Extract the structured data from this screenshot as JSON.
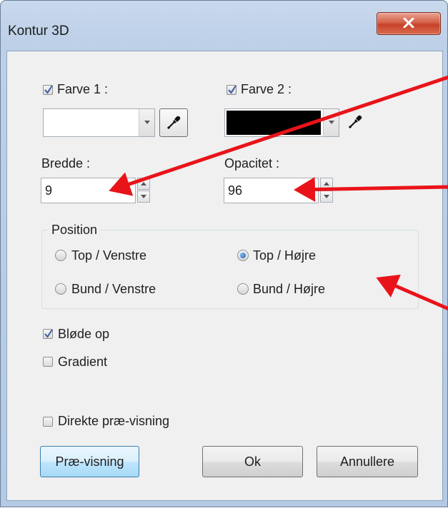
{
  "window": {
    "title": "Kontur 3D",
    "close_symbol": "X"
  },
  "color1": {
    "label": "Farve 1 :",
    "checked": true,
    "swatch_color": "#ffffff"
  },
  "color2": {
    "label": "Farve 2 :",
    "checked": true,
    "swatch_color": "#000000"
  },
  "width": {
    "label": "Bredde :",
    "value": "9"
  },
  "opacity": {
    "label": "Opacitet :",
    "value": "96"
  },
  "position": {
    "legend": "Position",
    "options": [
      {
        "label": "Top / Venstre",
        "selected": false
      },
      {
        "label": "Top / Højre",
        "selected": true
      },
      {
        "label": "Bund / Venstre",
        "selected": false
      },
      {
        "label": "Bund / Højre",
        "selected": false
      }
    ]
  },
  "options": {
    "blur_label": "Bløde op",
    "blur_checked": true,
    "gradient_label": "Gradient",
    "gradient_checked": false,
    "direct_preview_label": "Direkte præ-visning",
    "direct_preview_checked": false
  },
  "buttons": {
    "preview": "Præ-visning",
    "ok": "Ok",
    "cancel": "Annullere"
  },
  "annotation_color": "#e8141a",
  "icons": [
    "close-icon",
    "eyedropper-icon",
    "checkmark-icon",
    "dropdown-arrow-icon",
    "spin-up-icon",
    "spin-down-icon"
  ]
}
